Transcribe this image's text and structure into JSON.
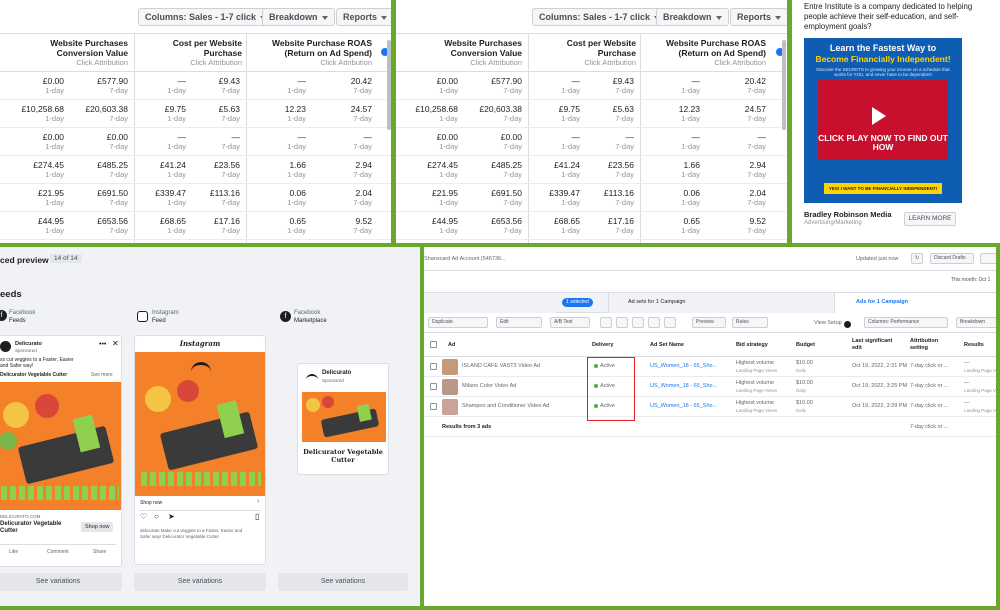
{
  "reports": {
    "columns_button": "Columns: Sales - 1-7 click",
    "breakdown_button": "Breakdown",
    "reports_button": "Reports",
    "headers": [
      {
        "title": "Website Purchases Conversion Value",
        "attribution": "Click Attribution"
      },
      {
        "title": "Cost per Website Purchase",
        "attribution": "Click Attribution"
      },
      {
        "title": "Website Purchase ROAS (Return on Ad Spend)",
        "attribution": "Click Attribution"
      }
    ],
    "window_1": "1-day",
    "window_7": "7-day",
    "rows": [
      [
        "£0.00",
        "£577.90",
        "—",
        "£9.43",
        "—",
        "20.42"
      ],
      [
        "£10,258.68",
        "£20,603.38",
        "£9.75",
        "£5.63",
        "12.23",
        "24.57"
      ],
      [
        "£0.00",
        "£0.00",
        "—",
        "—",
        "—",
        "—"
      ],
      [
        "£274.45",
        "£485.25",
        "£41.24",
        "£23.56",
        "1.66",
        "2.94"
      ],
      [
        "£21.95",
        "£691.50",
        "£339.47",
        "£113.16",
        "0.06",
        "2.04"
      ],
      [
        "£44.95",
        "£653.56",
        "£68.65",
        "£17.16",
        "0.65",
        "9.52"
      ]
    ]
  },
  "ad": {
    "heading": "Entre Institute is a company dedicated to helping people achieve their self-education, and self-employment goals?",
    "banner_line1": "Learn the Fastest Way to",
    "banner_line2": "Become Financially Independent!",
    "banner_small": "Discover the SECRETS to growing your income on a schedule that works for YOU, and never have to be dependent!",
    "video_text": "CLICK PLAY NOW TO FIND OUT HOW",
    "yellow_button": "YES! I WANT TO BE FINANCIALLY INDEPENDENT!",
    "advertiser": "Bradley Robinson Media",
    "advertiser_sub": "Advertising/Marketing",
    "learn_more": "LEARN MORE"
  },
  "preview": {
    "title": "ced preview",
    "count": "14 of 14",
    "section": "eeds",
    "placements": [
      {
        "platform": "Facebook",
        "name": "Feeds"
      },
      {
        "platform": "Instagram",
        "name": "Feed"
      },
      {
        "platform": "Facebook",
        "name": "Marketplace"
      }
    ],
    "fb_page": "Delicurato",
    "fb_sponsored": "Sponsored",
    "fb_text": "ss cut veggies to a Faster, Easier and Safer way!",
    "fb_text2": "Delicurator Vegetable Cutter",
    "fb_see_more": "See more",
    "fb_domain": "DELICURATO.COM",
    "fb_headline": "Delicurator Vegetable Cutter",
    "fb_shop": "Shop now",
    "fb_like": "Like",
    "fb_comment": "Comment",
    "fb_share": "Share",
    "ig_brand": "Instagram",
    "ig_shop": "Shop now",
    "ig_caption": "delicurato Make cut veggies to a Faster, Easier and Safer way! Delicurator Vegetable Cutter",
    "mp_brand": "Delicurato",
    "mp_sponsored": "Sponsored",
    "mp_headline": "Delicurator Vegetable Cutter",
    "see_variations": "See variations"
  },
  "ads_manager": {
    "account": "Shanscard Ad Account (545736...",
    "updated": "Updated just now",
    "discard": "Discard Drafts",
    "date_range": "This month: Oct 1",
    "selected_pill": "1 selected",
    "tab_adsets": "Ad sets for 1 Campaign",
    "tab_ads": "Ads for 1 Campaign",
    "duplicate": "Duplicate",
    "edit": "Edit",
    "ab_test": "A/B Test",
    "preview_btn": "Preview",
    "rules": "Rules",
    "view_setup": "View Setup",
    "columns_perf": "Columns: Performance",
    "breakdown": "Breakdown",
    "headers": [
      "Ad",
      "Delivery",
      "Ad Set Name",
      "Bid strategy",
      "Budget",
      "Last significant edit",
      "Attribution setting",
      "Results"
    ],
    "rows": [
      {
        "ad": "ISLAND CAFE VAST3 Video Ad",
        "delivery": "Active",
        "adset": "US_Women_18 - 65_Sho...",
        "bid": "Highest volume",
        "bid_sub": "Landing Page Views",
        "budget": "$10.00",
        "budget_sub": "Daily",
        "edit": "Oct 19, 2022, 2:31 PM",
        "attr": "7-day click or ...",
        "results": "—",
        "results_sub": "Landing Page Views"
      },
      {
        "ad": "Milano Color Video Ad",
        "delivery": "Active",
        "adset": "US_Women_18 - 65_Sho...",
        "bid": "Highest volume",
        "bid_sub": "Landing Page Views",
        "budget": "$10.00",
        "budget_sub": "Daily",
        "edit": "Oct 19, 2022, 3:25 PM",
        "attr": "7-day click or ...",
        "results": "—",
        "results_sub": "Landing Page Views"
      },
      {
        "ad": "Shampoo and Conditioner Video Ad",
        "delivery": "Active",
        "adset": "US_Women_18 - 65_Sho...",
        "bid": "Highest volume",
        "bid_sub": "Landing Page Views",
        "budget": "$10.00",
        "budget_sub": "Daily",
        "edit": "Oct 19, 2022, 3:29 PM",
        "attr": "7-day click or ...",
        "results": "—",
        "results_sub": "Landing Page Views"
      }
    ],
    "results_footer": "Results from 3 ads",
    "footer_attr": "7-day click or ..."
  },
  "colors": {
    "border_green": "#6aa82a",
    "fb_blue": "#1877f2",
    "orange": "#f4802a",
    "highlight_red": "#e02020"
  }
}
